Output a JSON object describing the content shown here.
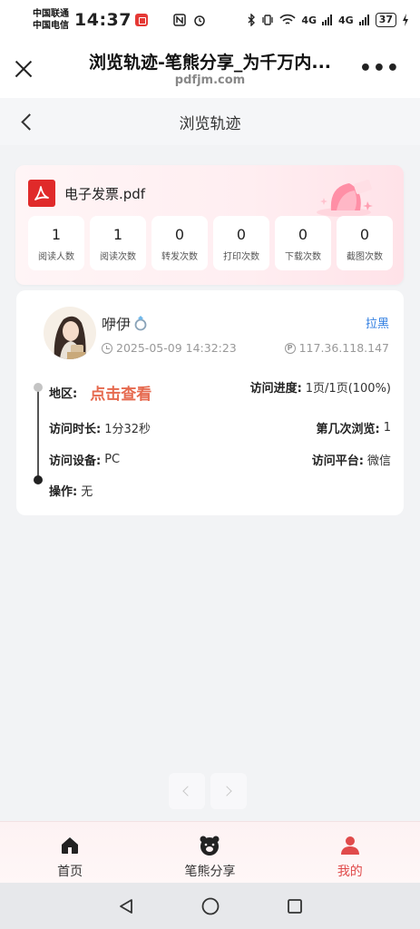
{
  "status_bar": {
    "carrier1": "中国联通",
    "carrier2": "中国电信",
    "time": "14:37",
    "signal1": "4G",
    "signal2": "4G",
    "battery": "37"
  },
  "browser": {
    "title": "浏览轨迹-笔熊分享_为千万内...",
    "domain": "pdfjm.com",
    "more": "•••"
  },
  "nav": {
    "title": "浏览轨迹"
  },
  "file": {
    "name": "电子发票.pdf",
    "stats": [
      {
        "value": "1",
        "label": "阅读人数"
      },
      {
        "value": "1",
        "label": "阅读次数"
      },
      {
        "value": "0",
        "label": "转发次数"
      },
      {
        "value": "0",
        "label": "打印次数"
      },
      {
        "value": "0",
        "label": "下载次数"
      },
      {
        "value": "0",
        "label": "截图次数"
      }
    ]
  },
  "visit": {
    "user_name": "咿伊",
    "block": "拉黑",
    "time": "2025-05-09 14:32:23",
    "ip": "117.36.118.147",
    "region_key": "地区:",
    "region_link": "点击查看",
    "progress_key": "访问进度:",
    "progress_val": "1页/1页(100%)",
    "duration_key": "访问时长:",
    "duration_val": "1分32秒",
    "nth_key": "第几次浏览:",
    "nth_val": "1",
    "device_key": "访问设备:",
    "device_val": "PC",
    "platform_key": "访问平台:",
    "platform_val": "微信",
    "op_key": "操作:",
    "op_val": "无"
  },
  "tabs": [
    {
      "label": "首页",
      "icon": "home-icon"
    },
    {
      "label": "笔熊分享",
      "icon": "bear-icon"
    },
    {
      "label": "我的",
      "icon": "user-icon"
    }
  ],
  "colors": {
    "accent": "#e04b4b",
    "link": "#2f7de1",
    "region_link": "#e66a4f"
  }
}
